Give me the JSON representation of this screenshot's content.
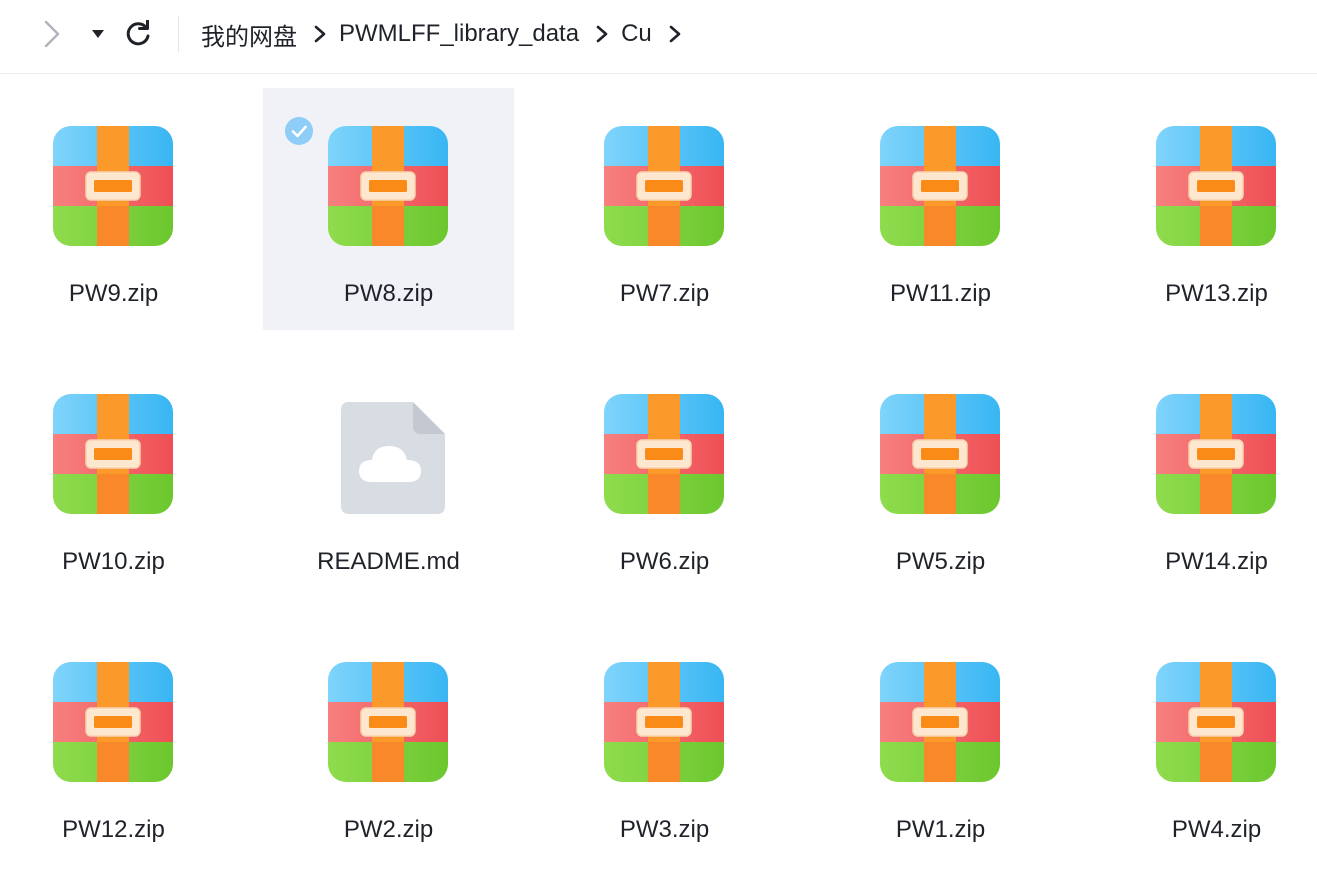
{
  "toolbar": {
    "forward_icon": "chevron-right-icon",
    "dropdown_icon": "caret-down-icon",
    "refresh_icon": "refresh-icon"
  },
  "breadcrumb": {
    "items": [
      "我的网盘",
      "PWMLFF_library_data",
      "Cu"
    ],
    "separator_icon": "chevron-right-icon"
  },
  "files": [
    {
      "name": "PW9.zip",
      "type": "zip",
      "selected": false
    },
    {
      "name": "PW8.zip",
      "type": "zip",
      "selected": true
    },
    {
      "name": "PW7.zip",
      "type": "zip",
      "selected": false
    },
    {
      "name": "PW11.zip",
      "type": "zip",
      "selected": false
    },
    {
      "name": "PW13.zip",
      "type": "zip",
      "selected": false
    },
    {
      "name": "PW10.zip",
      "type": "zip",
      "selected": false
    },
    {
      "name": "README.md",
      "type": "md",
      "selected": false
    },
    {
      "name": "PW6.zip",
      "type": "zip",
      "selected": false
    },
    {
      "name": "PW5.zip",
      "type": "zip",
      "selected": false
    },
    {
      "name": "PW14.zip",
      "type": "zip",
      "selected": false
    },
    {
      "name": "PW12.zip",
      "type": "zip",
      "selected": false
    },
    {
      "name": "PW2.zip",
      "type": "zip",
      "selected": false
    },
    {
      "name": "PW3.zip",
      "type": "zip",
      "selected": false
    },
    {
      "name": "PW1.zip",
      "type": "zip",
      "selected": false
    },
    {
      "name": "PW4.zip",
      "type": "zip",
      "selected": false
    }
  ],
  "colors": {
    "selection_bg": "#f1f2f7",
    "check_blue": "#8ecdf7",
    "zip_top": "#52c2f7",
    "zip_middle": "#f15a5f",
    "zip_bottom": "#7ad43c",
    "zip_strap": "#fb8b24",
    "md_icon": "#dfe2e8"
  }
}
